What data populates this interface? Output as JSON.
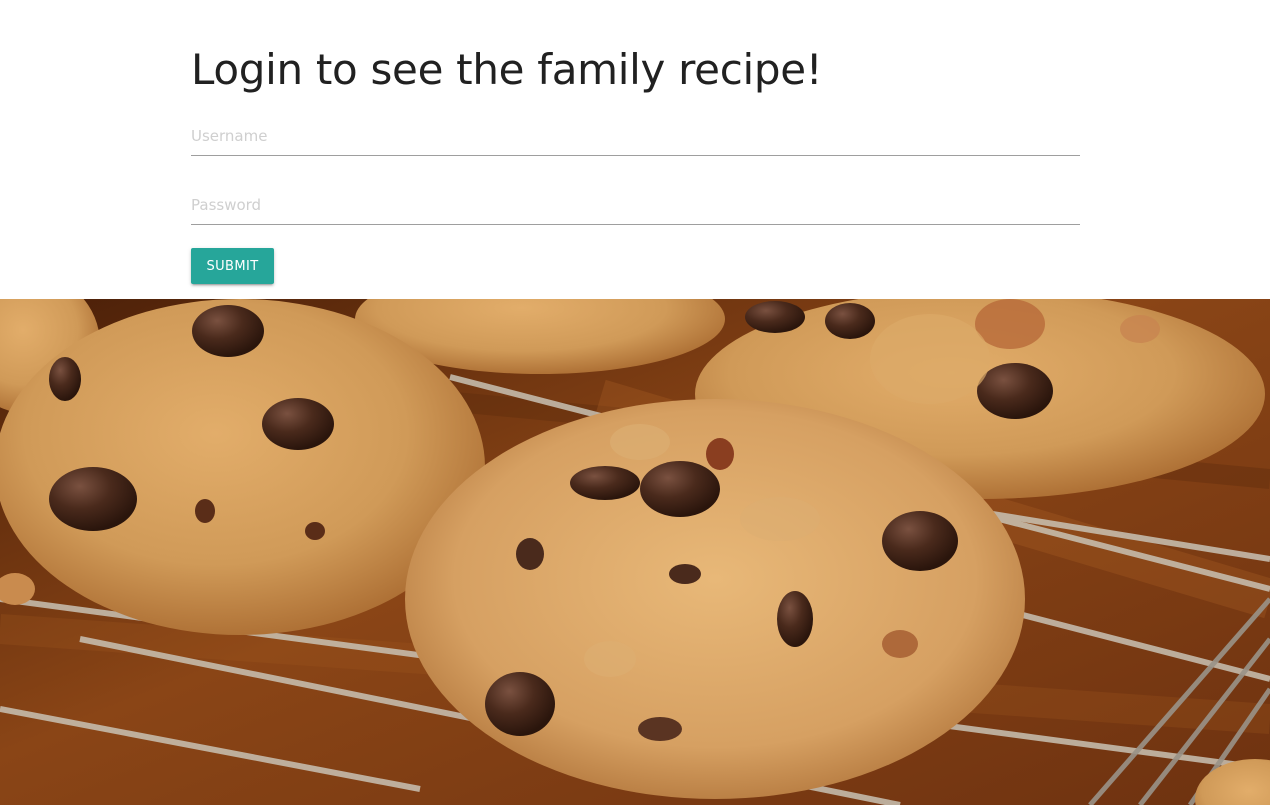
{
  "page": {
    "title": "Login to see the family recipe!"
  },
  "login_form": {
    "username_placeholder": "Username",
    "username_value": "",
    "password_placeholder": "Password",
    "password_value": "",
    "submit_label": "Submit"
  },
  "hero": {
    "alt": "chocolate chip cookies on a cooling rack"
  },
  "colors": {
    "accent": "#26a69a",
    "title_text": "#212121",
    "input_underline": "#9e9e9e",
    "placeholder": "#cfcfcf"
  }
}
